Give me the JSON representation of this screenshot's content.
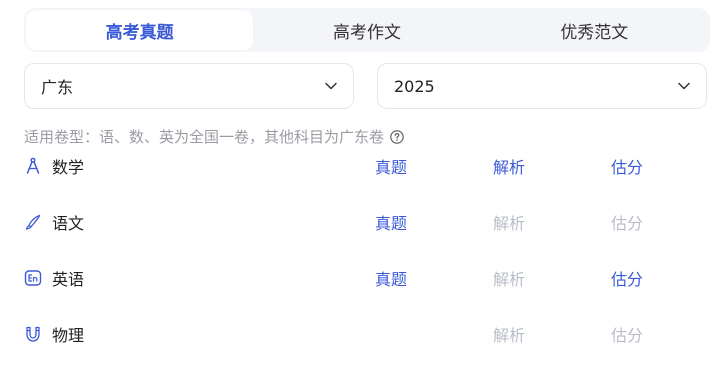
{
  "tabs": [
    {
      "label": "高考真题",
      "active": true
    },
    {
      "label": "高考作文",
      "active": false
    },
    {
      "label": "优秀范文",
      "active": false
    }
  ],
  "filters": {
    "province": "广东",
    "year": "2025"
  },
  "note": "适用卷型：语、数、英为全国一卷，其他科目为广东卷",
  "subjects": [
    {
      "name": "数学",
      "icon": "compass-icon",
      "paper": "真题",
      "analysis": "解析",
      "score": "估分"
    },
    {
      "name": "语文",
      "icon": "brush-icon",
      "paper": "真题",
      "analysis": "解析",
      "score": "估分"
    },
    {
      "name": "英语",
      "icon": "en-icon",
      "paper": "真题",
      "analysis": "解析",
      "score": "估分"
    },
    {
      "name": "物理",
      "icon": "magnet-icon",
      "paper": "",
      "analysis": "解析",
      "score": "估分"
    }
  ],
  "colors": {
    "accent": "#3b5ad8",
    "disabled": "#b9bdc7",
    "muted": "#9a9ca3"
  }
}
